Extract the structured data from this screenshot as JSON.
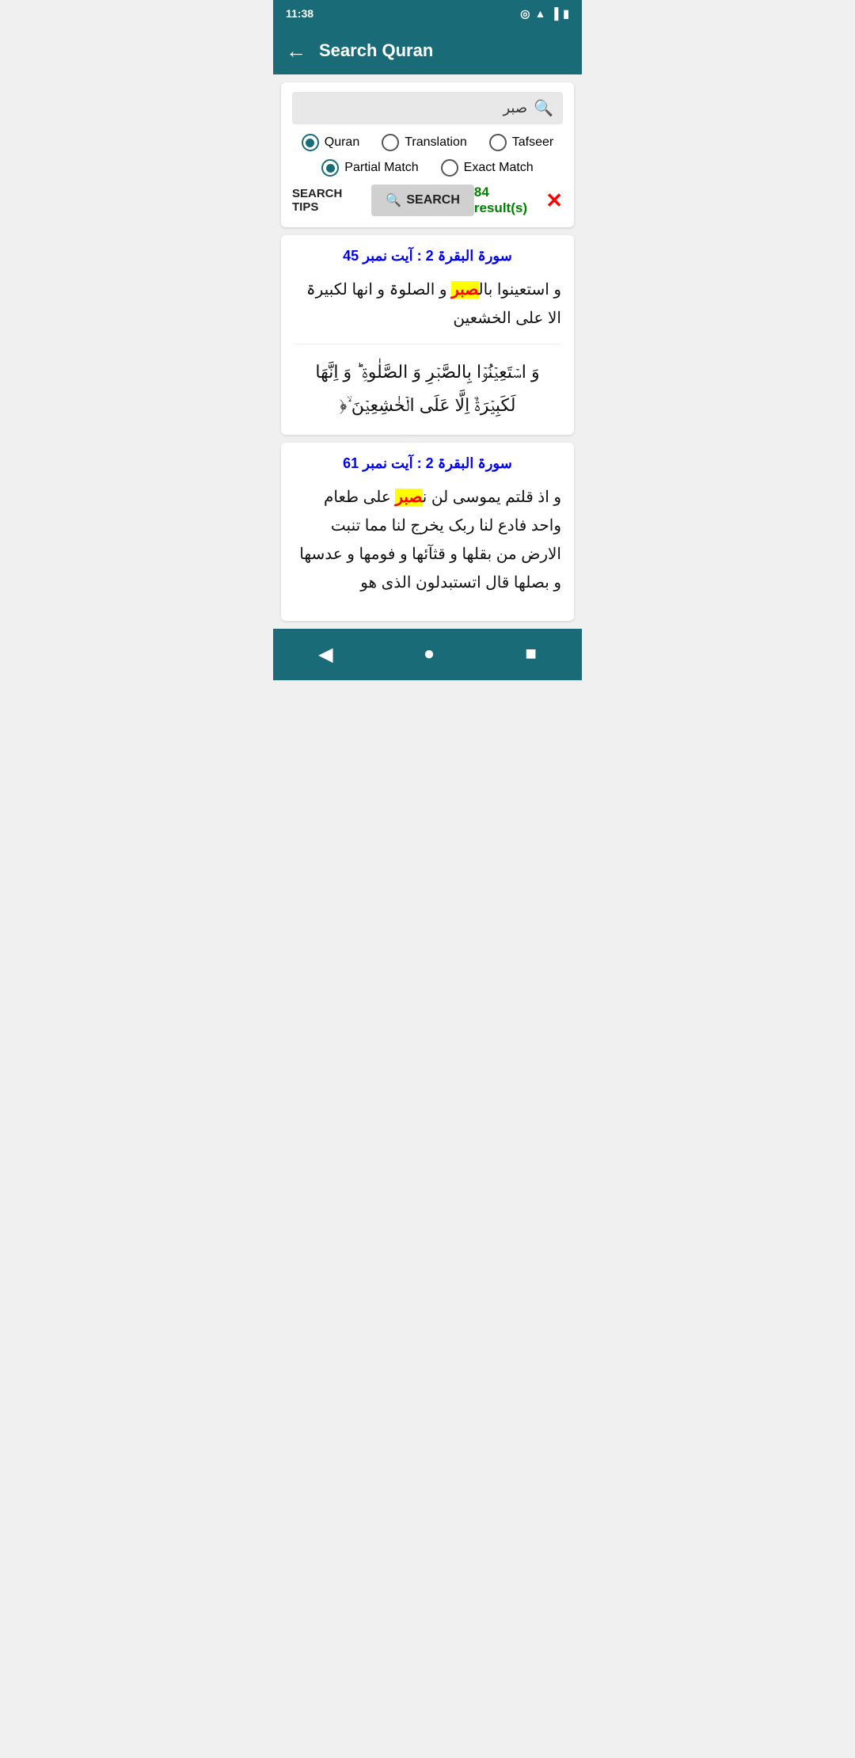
{
  "statusBar": {
    "time": "11:38",
    "icons": [
      "at",
      "wifi",
      "signal",
      "battery"
    ]
  },
  "appBar": {
    "title": "Search Quran",
    "backLabel": "←"
  },
  "searchPanel": {
    "inputValue": "صبر",
    "searchIconLabel": "🔍",
    "radioGroups": {
      "source": [
        {
          "id": "quran",
          "label": "Quran",
          "selected": true
        },
        {
          "id": "translation",
          "label": "Translation",
          "selected": false
        },
        {
          "id": "tafseer",
          "label": "Tafseer",
          "selected": false
        }
      ],
      "matchType": [
        {
          "id": "partial",
          "label": "Partial Match",
          "selected": true
        },
        {
          "id": "exact",
          "label": "Exact Match",
          "selected": false
        }
      ]
    },
    "searchTipsLabel": "SEARCH TIPS",
    "searchButtonLabel": "SEARCH",
    "searchButtonIcon": "🔍",
    "resultsCount": "84 result(s)",
    "clearLabel": "✕"
  },
  "results": [
    {
      "ref": "سورۃ البقرۃ 2 : آیت نمبر 45",
      "urduParts": [
        "و استعینوا بال",
        "صبر",
        " و الصلوۃ و انھا لکبیرۃ الا علی الخشعین"
      ],
      "arabic": "وَ اسۡتَعِیۡنُوۡا بِالصَّبۡرِ وَ الصَّلٰوۃِ ؕ وَ اِنَّھَا لَکَبِیۡرَۃٌ اِلَّا عَلَی الۡخٰشِعِیۡنَ ۙ﴿"
    },
    {
      "ref": "سورۃ البقرۃ 2 : آیت نمبر 61",
      "urduParts": [
        "و اذ قلتم یموسی لن ن",
        "صبر",
        " علی طعام واحد فادع لنا ربک یخرج لنا مما تنبت الارض من بقلھا و قثآئھا و فومھا و عدسھا و بصلھا قال اتستبدلون الذی ھو"
      ],
      "arabic": ""
    }
  ],
  "bottomNav": {
    "backLabel": "◀",
    "homeLabel": "●",
    "squareLabel": "■"
  }
}
